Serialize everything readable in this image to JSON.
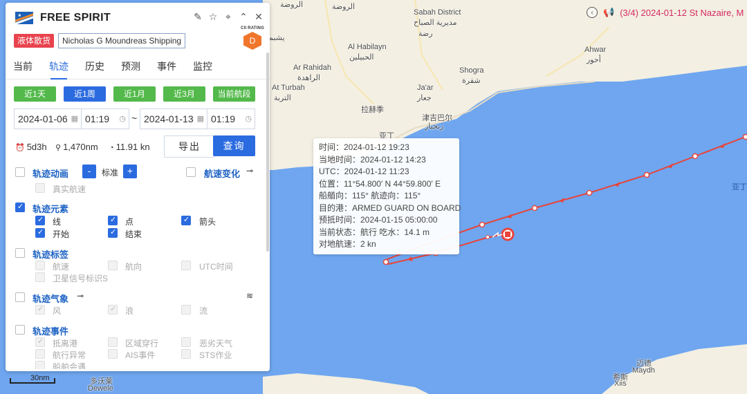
{
  "banner": {
    "text": "(3/4) 2024-01-12 St Nazaire, M"
  },
  "vessel": {
    "name": "FREE SPIRIT",
    "type_tag": "液体散货",
    "owner": "Nicholas G Moundreas Shipping",
    "cii_label": "CII RATING",
    "cii_grade": "D"
  },
  "tabs": [
    "当前",
    "轨迹",
    "历史",
    "预测",
    "事件",
    "监控"
  ],
  "active_tab": "轨迹",
  "ranges": [
    "近1天",
    "近1周",
    "近1月",
    "近3月",
    "当前航段"
  ],
  "active_range": "近1周",
  "dates": {
    "start_date": "2024-01-06",
    "start_time": "01:19",
    "separator": "~",
    "end_date": "2024-01-13",
    "end_time": "01:19"
  },
  "stats": {
    "duration": "5d3h",
    "distance": "1,470nm",
    "speed": "11.91 kn"
  },
  "buttons": {
    "export": "导出",
    "query": "查询"
  },
  "options": {
    "anim": {
      "title": "轨迹动画",
      "minus": "-",
      "speed_label": "标准",
      "plus": "+",
      "realtime": "真实航速",
      "speed_change": "航速变化"
    },
    "elements": {
      "title": "轨迹元素",
      "line": "线",
      "point": "点",
      "arrow": "箭头",
      "start": "开始",
      "end": "结束"
    },
    "labels": {
      "title": "轨迹标签",
      "speed": "航速",
      "heading": "航向",
      "utc": "UTC时间",
      "sat": "卫星信号标识S"
    },
    "weather": {
      "title": "轨迹气象",
      "wind": "风",
      "wave": "浪",
      "current": "流"
    },
    "events": {
      "title": "轨迹事件",
      "arrival": "抵离港",
      "area": "区域穿行",
      "bad_weather": "恶劣天气",
      "abnormal": "航行异常",
      "ais": "AIS事件",
      "sts": "STS作业",
      "encounter": "船舶会遇"
    }
  },
  "tooltip": {
    "time": "时间：2024-01-12 19:23",
    "local": "当地时间：2024-01-12 14:23",
    "utc": "UTC：2024-01-12 11:23",
    "position": "位置：11°54.800′ N  44°59.800′ E",
    "heading": "船艏向：115°   航迹向：115°",
    "dest": "目的港：ARMED GUARD ON BOARD",
    "eta": "预抵时间：2024-01-15 05:00:00",
    "status": "当前状态：航行   吃水：14.1 m",
    "sog": "对地航速：2 kn"
  },
  "map": {
    "scale": "30nm",
    "labels": {
      "ar_rawdah": "Ar Rawdah",
      "ar_rawdah_ar": "الروضة",
      "sabah": "Sabah District",
      "sabah_ar": "مديرية الصباح",
      "ridda": "رضة",
      "yashbum": "يشبم",
      "habilayn": "Al Habilayn",
      "habilayn_ar": "الحبيلين",
      "ahwar": "Ahwar",
      "ahwar_ar": "أحور",
      "rahidah": "Ar Rahidah",
      "rahidah_ar": "الراهدة",
      "shogra": "Shogra",
      "shogra_ar": "شقرة",
      "turbah": "At Turbah",
      "turbah_ar": "التربة",
      "jaar": "Ja'ar",
      "jaar_ar": "جعار",
      "lahij": "拉赫季",
      "zinjibar": "津吉巴尔",
      "zinjibar_ar": "زنجبار",
      "aden": "亚丁",
      "aden_gulf": "亚丁",
      "dewele_cn": "多沃莱",
      "dewele": "Dewele",
      "maydh_cn": "迈德",
      "maydh": "Maydh",
      "xiis_cn": "希斯",
      "xiis": "Xiis"
    }
  },
  "colors": {
    "accent": "#2b6be0",
    "green": "#52b94a",
    "track": "#e8443a",
    "banner": "#d42a63",
    "tag": "#e8434e"
  }
}
